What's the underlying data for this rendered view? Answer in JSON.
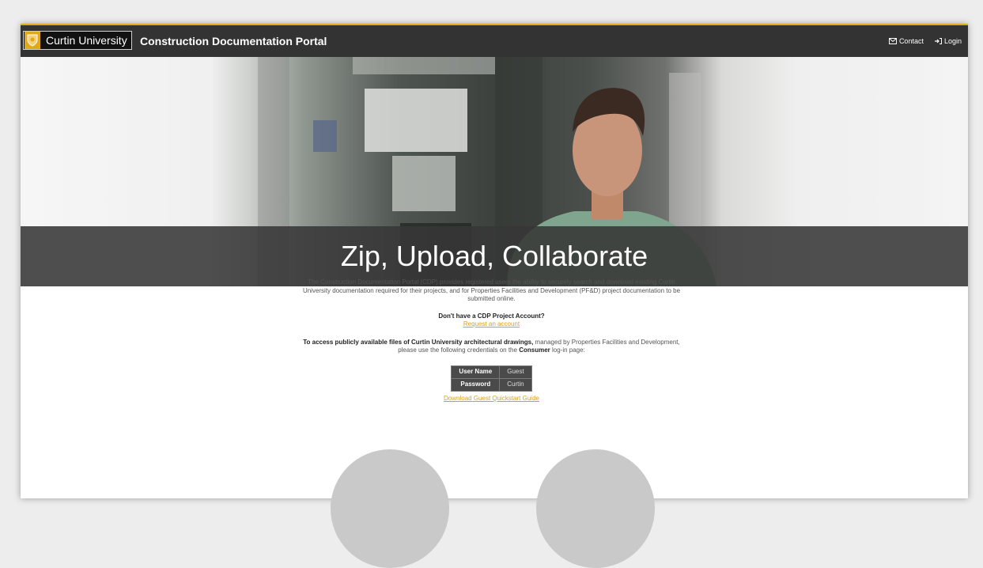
{
  "header": {
    "logo_text": "Curtin University",
    "portal_title": "Construction Documentation Portal",
    "contact_label": "Contact",
    "login_label": "Login"
  },
  "hero": {
    "title": "Zip, Upload, Collaborate"
  },
  "content": {
    "intro": "The Construction Documentation Portal (CDP) provides registered users the ability to securely search and download existing Curtin University documentation required for their projects, and for Properties Facilities and Development (PF&D) project documentation to be submitted online.",
    "account_question": "Don't have a CDP Project Account?",
    "request_link": "Request an account",
    "access_bold": "To access publicly available files of Curtin University architectural drawings,",
    "access_text": "managed by Properties Facilities and Development, please use the following credentials on the",
    "access_consumer": "Consumer",
    "access_tail": "log-in page:",
    "credentials": {
      "username_label": "User Name",
      "username_value": "Guest",
      "password_label": "Password",
      "password_value": "Curtin"
    },
    "guide_link": "Download Guest Quickstart Guide"
  },
  "colors": {
    "accent": "#e0a91b",
    "nav_bg": "#333333",
    "band_bg": "#373737"
  }
}
